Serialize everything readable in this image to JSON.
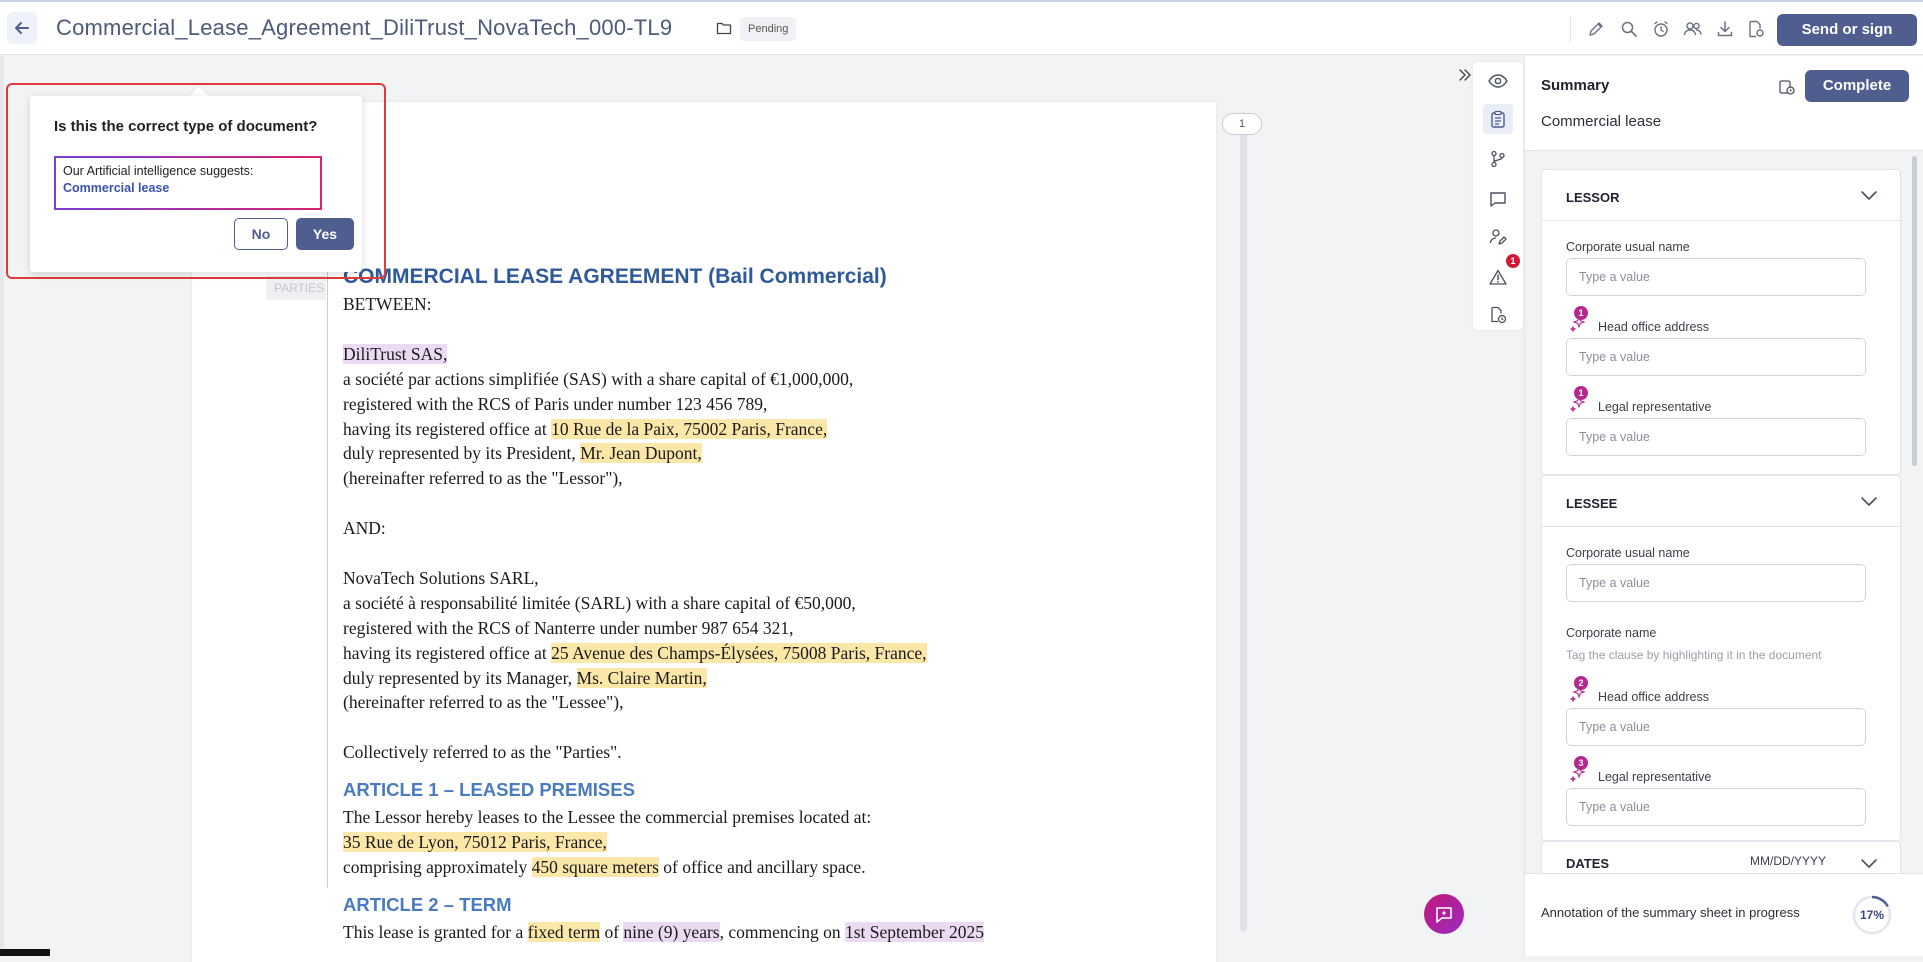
{
  "header": {
    "title": "Commercial_Lease_Agreement_DiliTrust_NovaTech_000-TL9",
    "status": "Pending",
    "send_label": "Send or sign",
    "icons": [
      "edit-icon",
      "search-icon",
      "alarm-icon",
      "users-icon",
      "download-icon",
      "document-settings-icon"
    ]
  },
  "popup": {
    "question": "Is this the correct type of document?",
    "suggestion_intro": "Our Artificial intelligence suggests:",
    "suggestion_value": "Commercial lease",
    "no_label": "No",
    "yes_label": "Yes"
  },
  "document": {
    "page_number": "1",
    "parties_tag": "PARTIES",
    "heading": "COMMERCIAL LEASE AGREEMENT (Bail Commercial)",
    "between": "BETWEEN:",
    "lessor_name": "DiliTrust SAS,",
    "lessor_l1": "a société par actions simplifiée (SAS) with a share capital of €1,000,000,",
    "lessor_l2": "registered with the RCS of Paris under number 123 456 789,",
    "lessor_l3_pre": "having its registered office at ",
    "lessor_address": "10 Rue de la Paix, 75002 Paris, France,",
    "lessor_l4_pre": "duly represented by its President, ",
    "lessor_rep": "Mr. Jean Dupont,",
    "lessor_l5": "(hereinafter referred to as the \"Lessor\"),",
    "and": "AND:",
    "lessee_name": "NovaTech Solutions SARL,",
    "lessee_l1": "a société à responsabilité limitée (SARL) with a share capital of €50,000,",
    "lessee_l2": "registered with the RCS of Nanterre under number 987 654 321,",
    "lessee_l3_pre": "having its registered office at ",
    "lessee_address": "25 Avenue des Champs-Élysées, 75008 Paris, France,",
    "lessee_l4_pre": "duly represented by its Manager, ",
    "lessee_rep": "Ms. Claire Martin,",
    "lessee_l5": "(hereinafter referred to as the \"Lessee\"),",
    "collectively": "Collectively referred to as the \"Parties\".",
    "article1_title": "ARTICLE 1 – LEASED PREMISES",
    "article1_l1": "The Lessor hereby leases to the Lessee the commercial premises located at:",
    "article1_address": "35 Rue de Lyon, 75012 Paris, France,",
    "article1_l3_pre": "comprising approximately ",
    "article1_area": "450 square meters",
    "article1_l3_post": " of office and ancillary space.",
    "article2_title": "ARTICLE 2 – TERM",
    "article2_l1_pre": "This lease is granted for a ",
    "article2_fixed": "fixed term",
    "article2_of": " of ",
    "article2_years": "nine (9) years",
    "article2_comm": ", commencing on ",
    "article2_date": "1st September 2025"
  },
  "rail": {
    "icons": [
      "eye-icon",
      "clipboard-icon",
      "branch-icon",
      "comment-icon",
      "user-edit-icon",
      "warning-icon",
      "document-clock-icon"
    ],
    "warning_count": "1"
  },
  "summary": {
    "title": "Summary",
    "complete_label": "Complete",
    "doc_type": "Commercial lease",
    "lessor": {
      "title": "LESSOR",
      "corp_usual_label": "Corporate usual name",
      "placeholder": "Type a value",
      "head_office_label": "Head office address",
      "head_office_count": "1",
      "legal_rep_label": "Legal representative",
      "legal_rep_count": "1"
    },
    "lessee": {
      "title": "LESSEE",
      "corp_usual_label": "Corporate usual name",
      "corp_name_label": "Corporate name",
      "corp_name_hint": "Tag the clause by highlighting it in the document",
      "placeholder": "Type a value",
      "head_office_label": "Head office address",
      "head_office_count": "2",
      "legal_rep_label": "Legal representative",
      "legal_rep_count": "3"
    },
    "dates": {
      "title": "DATES",
      "format": "MM/DD/YYYY"
    },
    "footer_text": "Annotation of the summary sheet in progress",
    "progress": 17,
    "progress_label": "17%"
  },
  "colors": {
    "primary": "#4f5d8f",
    "highlight_yellow": "#fbe7a8",
    "highlight_purple": "#ecd9f2",
    "badge_red": "#d11a3a",
    "ai_magenta": "#b5298f"
  }
}
